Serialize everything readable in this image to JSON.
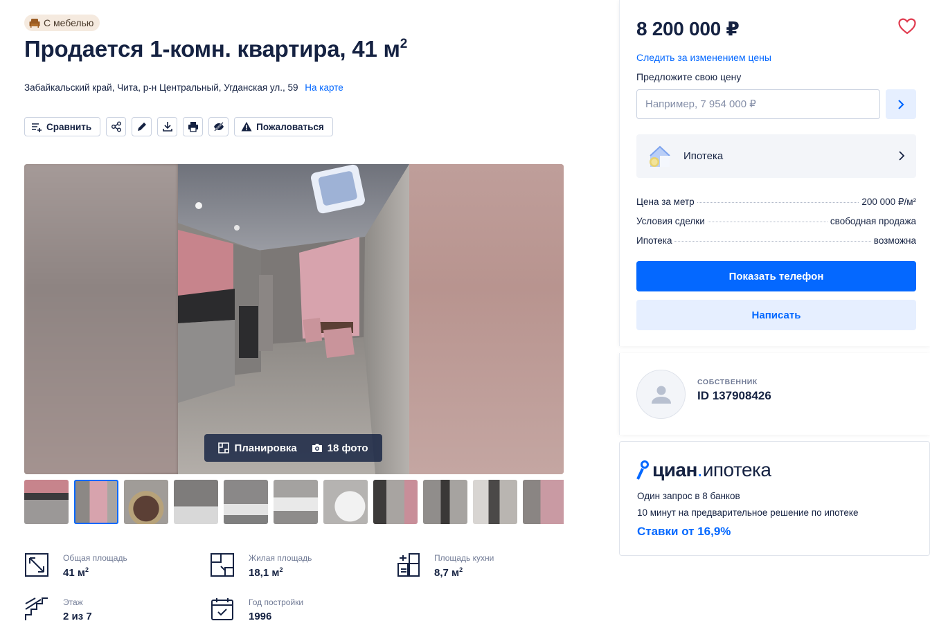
{
  "badge": {
    "label": "С мебелью",
    "icon": "armchair-icon"
  },
  "title": {
    "text": "Продается 1-комн. квартира, 41 м",
    "sup": "2"
  },
  "address": {
    "text": "Забайкальский край, Чита, р-н Центральный, Угданская ул., 59",
    "map_link": "На карте"
  },
  "actions": {
    "compare": "Сравнить",
    "share_icon": "share-icon",
    "edit_icon": "pencil-icon",
    "download_icon": "download-icon",
    "print_icon": "printer-icon",
    "hide_icon": "eye-off-icon",
    "report": "Пожаловаться"
  },
  "gallery": {
    "plan_label": "Планировка",
    "photos_label": "18 фото",
    "thumbnail_count": 11,
    "active_thumbnail": 2
  },
  "facts": [
    {
      "label": "Общая площадь",
      "value": "41 м",
      "sup": "2",
      "icon": "area-arrows-icon"
    },
    {
      "label": "Жилая площадь",
      "value": "18,1 м",
      "sup": "2",
      "icon": "floorplan-icon"
    },
    {
      "label": "Площадь кухни",
      "value": "8,7 м",
      "sup": "2",
      "icon": "kitchen-icon"
    },
    {
      "label": "Этаж",
      "value": "2 из 7",
      "icon": "stairs-icon"
    },
    {
      "label": "Год постройки",
      "value": "1996",
      "icon": "calendar-icon"
    }
  ],
  "price_card": {
    "price": "8 200 000 ₽",
    "follow_price": "Следить за изменением цены",
    "offer_label": "Предложите свою цену",
    "offer_placeholder": "Например, 7 954 000 ₽",
    "mortgage_label": "Ипотека",
    "details": [
      {
        "key": "Цена за метр",
        "value": "200 000 ₽/м²"
      },
      {
        "key": "Условия сделки",
        "value": "свободная продажа"
      },
      {
        "key": "Ипотека",
        "value": "возможна"
      }
    ],
    "show_phone": "Показать телефон",
    "write": "Написать"
  },
  "owner": {
    "role": "СОБСТВЕННИК",
    "id": "ID 137908426"
  },
  "cian": {
    "logo_main": "циан",
    "logo_dot": ".",
    "logo_sub": "ипотека",
    "line1": "Один запрос в 8 банков",
    "line2": "10 минут на предварительное решение по ипотеке",
    "rate": "Ставки от 16,9%"
  },
  "colors": {
    "accent": "#0468ff",
    "text": "#152242",
    "muted": "#707a95",
    "heart": "#e03b4f",
    "badge_bg": "#f5eadf"
  }
}
